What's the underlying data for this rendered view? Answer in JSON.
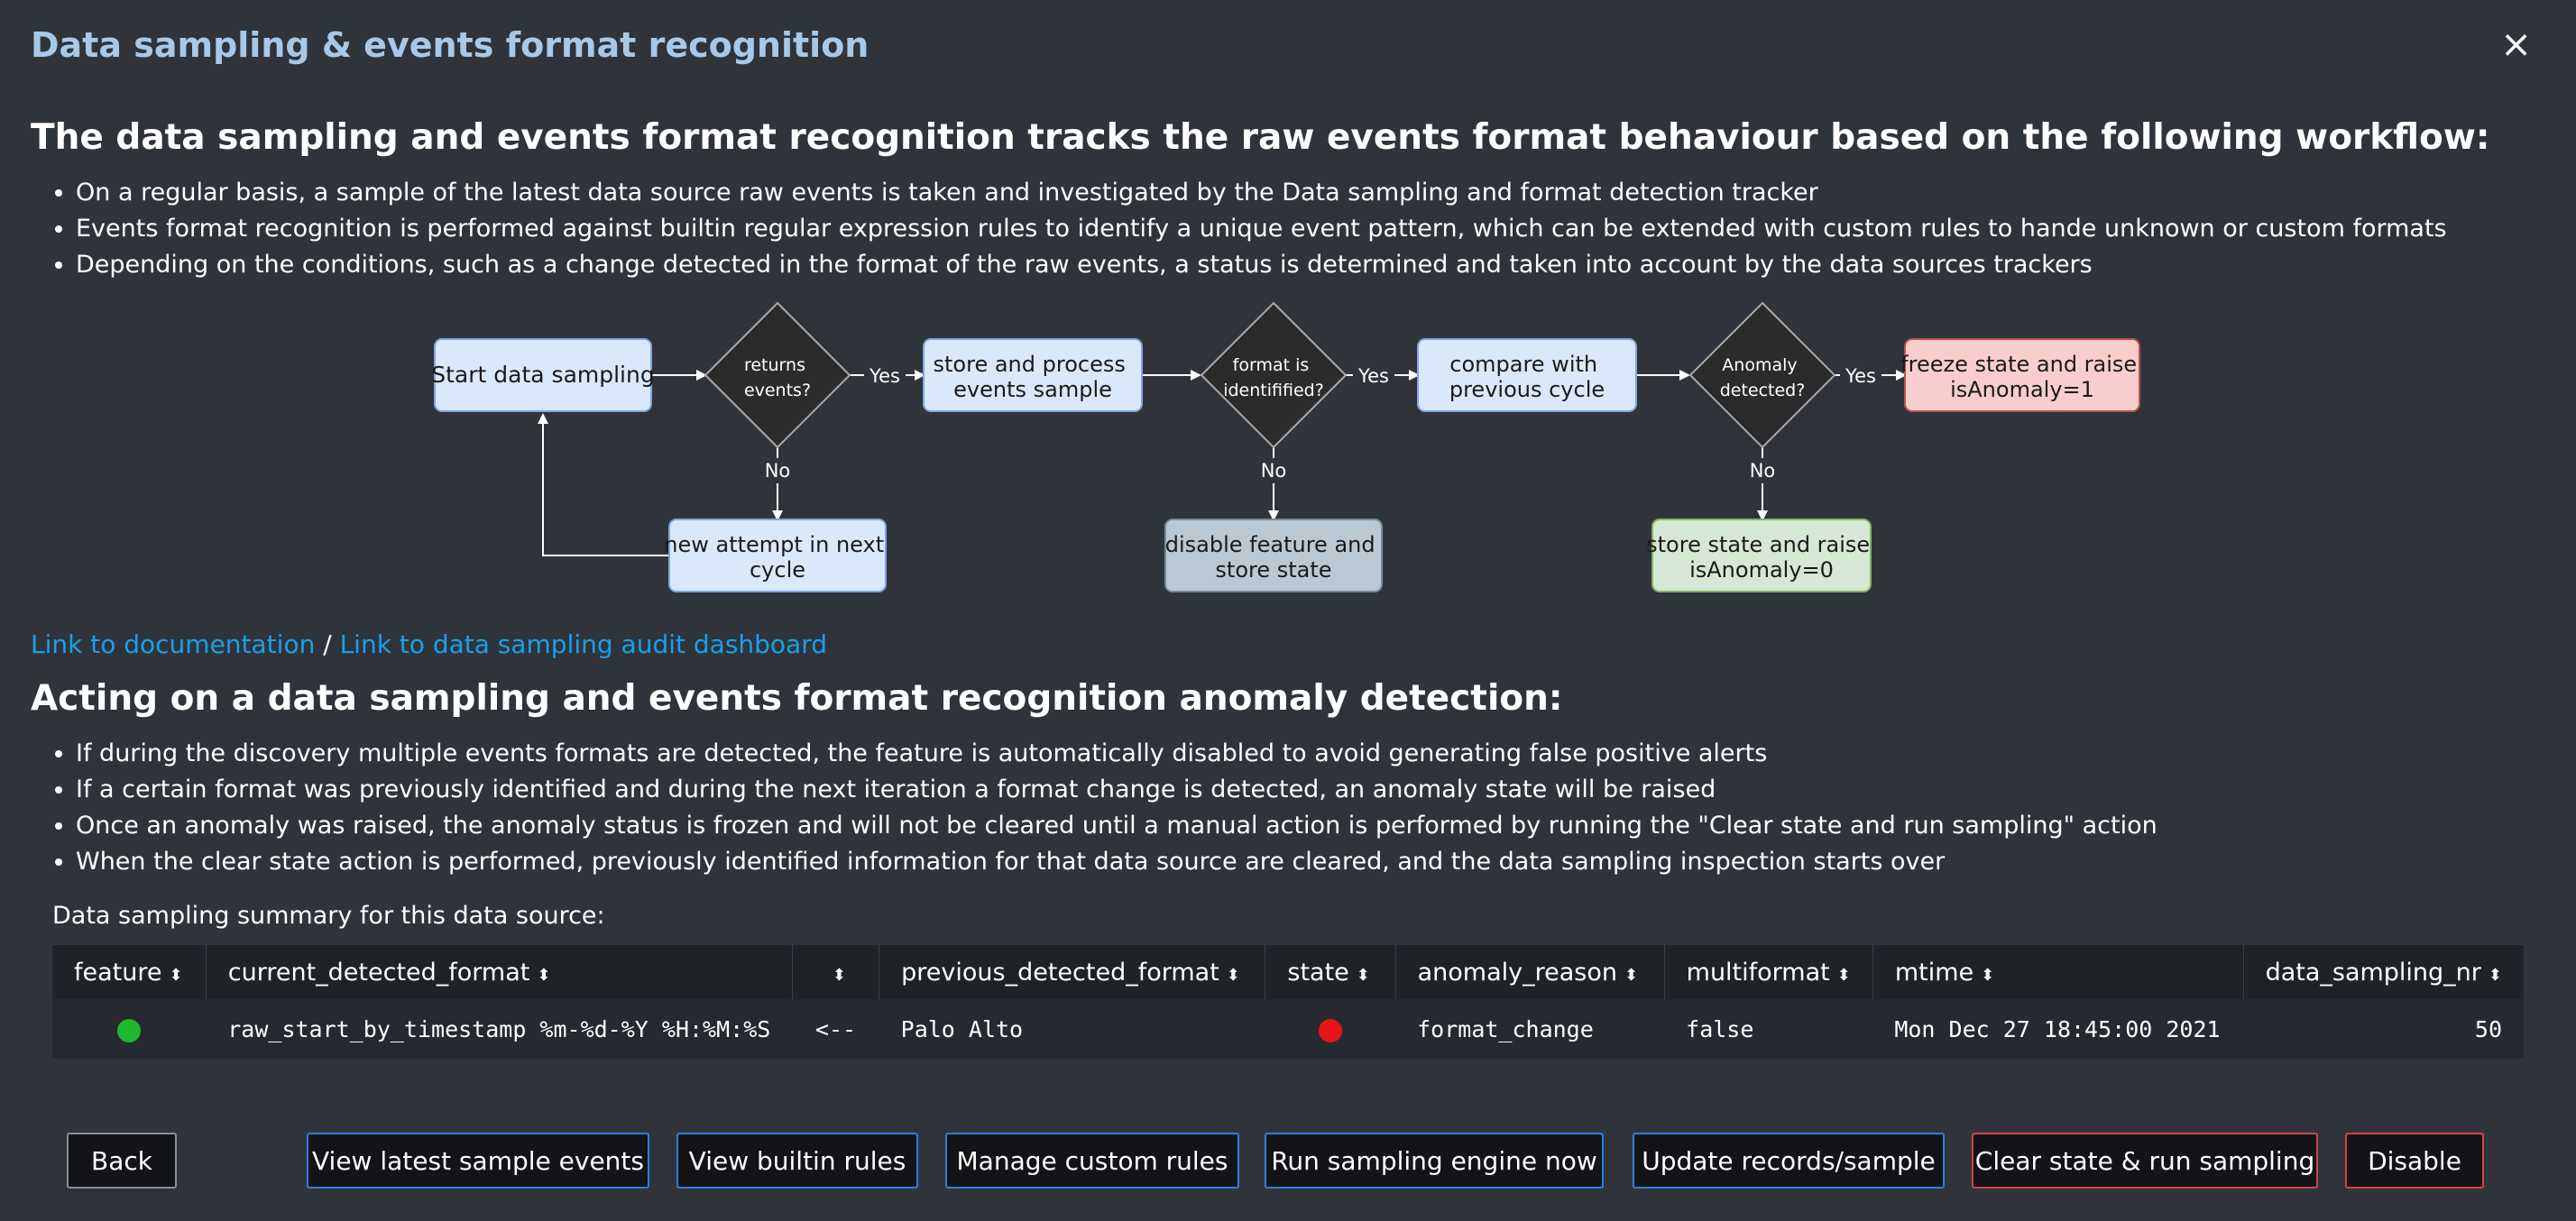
{
  "header": {
    "title": "Data sampling & events format recognition",
    "close_symbol": "×"
  },
  "section1": {
    "heading": "The data sampling and events format recognition tracks the raw events format behaviour based on the following workflow:",
    "bullets": [
      "On a regular basis, a sample of the latest data source raw events is taken and investigated by the Data sampling and format detection tracker",
      "Events format recognition is performed against builtin regular expression rules to identify a unique event pattern, which can be extended with custom rules to hande unknown or custom formats",
      "Depending on the conditions, such as a change detected in the format of the raw events, a status is determined and taken into account by the data sources trackers"
    ]
  },
  "flowchart": {
    "start": "Start data sampling",
    "d1": [
      "returns",
      "events?"
    ],
    "store": [
      "store and process",
      "events sample"
    ],
    "d2": [
      "format is",
      "identifified?"
    ],
    "compare": [
      "compare with",
      "previous cycle"
    ],
    "d3": [
      "Anomaly",
      "detected?"
    ],
    "freeze": [
      "freeze state and raise",
      "isAnomaly=1"
    ],
    "retry": [
      "new attempt in next",
      "cycle"
    ],
    "disable": [
      "disable feature and",
      "store state"
    ],
    "store_ok": [
      "store state and raise",
      "isAnomaly=0"
    ],
    "yes": "Yes",
    "no": "No"
  },
  "links": {
    "documentation": "Link to documentation",
    "separator": " / ",
    "audit": "Link to data sampling audit dashboard"
  },
  "section2": {
    "heading": "Acting on a data sampling and events format recognition anomaly detection:",
    "bullets": [
      "If during the discovery multiple events formats are detected, the feature is automatically disabled to avoid generating false positive alerts",
      "If a certain format was previously identified and during the next iteration a format change is detected, an anomaly state will be raised",
      "Once an anomaly was raised, the anomaly status is frozen and will not be cleared until a manual action is performed by running the \"Clear state and run sampling\" action",
      "When the clear state action is performed, previously identified information for that data source are cleared, and the data sampling inspection starts over"
    ]
  },
  "summary": {
    "label": "Data sampling summary for this data source:",
    "sort_icon": "⬍",
    "columns": [
      "feature",
      "current_detected_format",
      "",
      "previous_detected_format",
      "state",
      "anomaly_reason",
      "multiformat",
      "mtime",
      "data_sampling_nr"
    ],
    "row": {
      "feature_color": "#1fb82e",
      "current_detected_format": "raw_start_by_timestamp %m-%d-%Y %H:%M:%S",
      "arrow": "<--",
      "previous_detected_format": "Palo Alto",
      "state_color": "#e8141b",
      "anomaly_reason": "format_change",
      "multiformat": "false",
      "mtime": "Mon Dec 27 18:45:00 2021",
      "data_sampling_nr": "50"
    }
  },
  "buttons": {
    "back": "Back",
    "view_latest": "View latest sample events",
    "view_builtin": "View builtin rules",
    "manage_custom": "Manage custom rules",
    "run_engine": "Run sampling engine now",
    "update_records": "Update records/sample",
    "clear_state": "Clear state & run sampling",
    "disable": "Disable"
  },
  "colors": {
    "background": "#2f343b",
    "title": "#a8c8e8",
    "link": "#1a9fea",
    "primary_border": "#2b80e0",
    "danger_border": "#d0444b"
  }
}
